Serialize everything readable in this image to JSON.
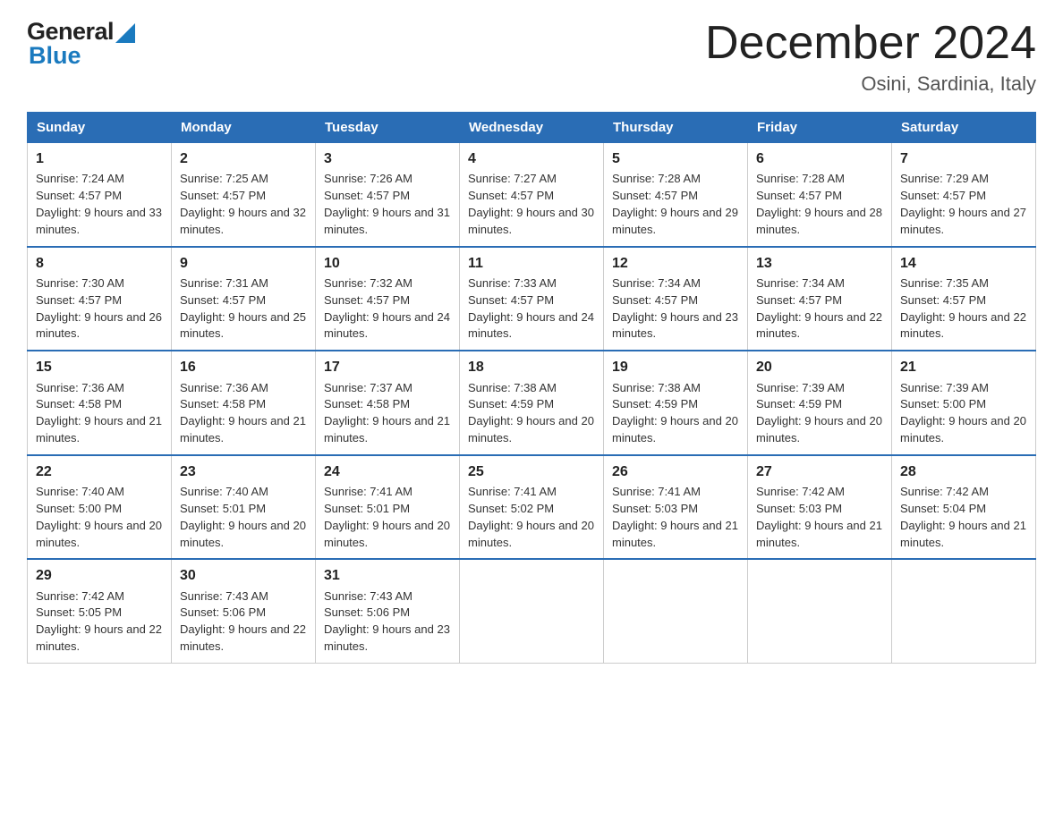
{
  "header": {
    "logo_general": "General",
    "logo_blue": "Blue",
    "title": "December 2024",
    "subtitle": "Osini, Sardinia, Italy"
  },
  "days_of_week": [
    "Sunday",
    "Monday",
    "Tuesday",
    "Wednesday",
    "Thursday",
    "Friday",
    "Saturday"
  ],
  "weeks": [
    [
      {
        "day": "1",
        "sunrise": "7:24 AM",
        "sunset": "4:57 PM",
        "daylight": "9 hours and 33 minutes."
      },
      {
        "day": "2",
        "sunrise": "7:25 AM",
        "sunset": "4:57 PM",
        "daylight": "9 hours and 32 minutes."
      },
      {
        "day": "3",
        "sunrise": "7:26 AM",
        "sunset": "4:57 PM",
        "daylight": "9 hours and 31 minutes."
      },
      {
        "day": "4",
        "sunrise": "7:27 AM",
        "sunset": "4:57 PM",
        "daylight": "9 hours and 30 minutes."
      },
      {
        "day": "5",
        "sunrise": "7:28 AM",
        "sunset": "4:57 PM",
        "daylight": "9 hours and 29 minutes."
      },
      {
        "day": "6",
        "sunrise": "7:28 AM",
        "sunset": "4:57 PM",
        "daylight": "9 hours and 28 minutes."
      },
      {
        "day": "7",
        "sunrise": "7:29 AM",
        "sunset": "4:57 PM",
        "daylight": "9 hours and 27 minutes."
      }
    ],
    [
      {
        "day": "8",
        "sunrise": "7:30 AM",
        "sunset": "4:57 PM",
        "daylight": "9 hours and 26 minutes."
      },
      {
        "day": "9",
        "sunrise": "7:31 AM",
        "sunset": "4:57 PM",
        "daylight": "9 hours and 25 minutes."
      },
      {
        "day": "10",
        "sunrise": "7:32 AM",
        "sunset": "4:57 PM",
        "daylight": "9 hours and 24 minutes."
      },
      {
        "day": "11",
        "sunrise": "7:33 AM",
        "sunset": "4:57 PM",
        "daylight": "9 hours and 24 minutes."
      },
      {
        "day": "12",
        "sunrise": "7:34 AM",
        "sunset": "4:57 PM",
        "daylight": "9 hours and 23 minutes."
      },
      {
        "day": "13",
        "sunrise": "7:34 AM",
        "sunset": "4:57 PM",
        "daylight": "9 hours and 22 minutes."
      },
      {
        "day": "14",
        "sunrise": "7:35 AM",
        "sunset": "4:57 PM",
        "daylight": "9 hours and 22 minutes."
      }
    ],
    [
      {
        "day": "15",
        "sunrise": "7:36 AM",
        "sunset": "4:58 PM",
        "daylight": "9 hours and 21 minutes."
      },
      {
        "day": "16",
        "sunrise": "7:36 AM",
        "sunset": "4:58 PM",
        "daylight": "9 hours and 21 minutes."
      },
      {
        "day": "17",
        "sunrise": "7:37 AM",
        "sunset": "4:58 PM",
        "daylight": "9 hours and 21 minutes."
      },
      {
        "day": "18",
        "sunrise": "7:38 AM",
        "sunset": "4:59 PM",
        "daylight": "9 hours and 20 minutes."
      },
      {
        "day": "19",
        "sunrise": "7:38 AM",
        "sunset": "4:59 PM",
        "daylight": "9 hours and 20 minutes."
      },
      {
        "day": "20",
        "sunrise": "7:39 AM",
        "sunset": "4:59 PM",
        "daylight": "9 hours and 20 minutes."
      },
      {
        "day": "21",
        "sunrise": "7:39 AM",
        "sunset": "5:00 PM",
        "daylight": "9 hours and 20 minutes."
      }
    ],
    [
      {
        "day": "22",
        "sunrise": "7:40 AM",
        "sunset": "5:00 PM",
        "daylight": "9 hours and 20 minutes."
      },
      {
        "day": "23",
        "sunrise": "7:40 AM",
        "sunset": "5:01 PM",
        "daylight": "9 hours and 20 minutes."
      },
      {
        "day": "24",
        "sunrise": "7:41 AM",
        "sunset": "5:01 PM",
        "daylight": "9 hours and 20 minutes."
      },
      {
        "day": "25",
        "sunrise": "7:41 AM",
        "sunset": "5:02 PM",
        "daylight": "9 hours and 20 minutes."
      },
      {
        "day": "26",
        "sunrise": "7:41 AM",
        "sunset": "5:03 PM",
        "daylight": "9 hours and 21 minutes."
      },
      {
        "day": "27",
        "sunrise": "7:42 AM",
        "sunset": "5:03 PM",
        "daylight": "9 hours and 21 minutes."
      },
      {
        "day": "28",
        "sunrise": "7:42 AM",
        "sunset": "5:04 PM",
        "daylight": "9 hours and 21 minutes."
      }
    ],
    [
      {
        "day": "29",
        "sunrise": "7:42 AM",
        "sunset": "5:05 PM",
        "daylight": "9 hours and 22 minutes."
      },
      {
        "day": "30",
        "sunrise": "7:43 AM",
        "sunset": "5:06 PM",
        "daylight": "9 hours and 22 minutes."
      },
      {
        "day": "31",
        "sunrise": "7:43 AM",
        "sunset": "5:06 PM",
        "daylight": "9 hours and 23 minutes."
      },
      null,
      null,
      null,
      null
    ]
  ],
  "labels": {
    "sunrise": "Sunrise:",
    "sunset": "Sunset:",
    "daylight": "Daylight:"
  }
}
